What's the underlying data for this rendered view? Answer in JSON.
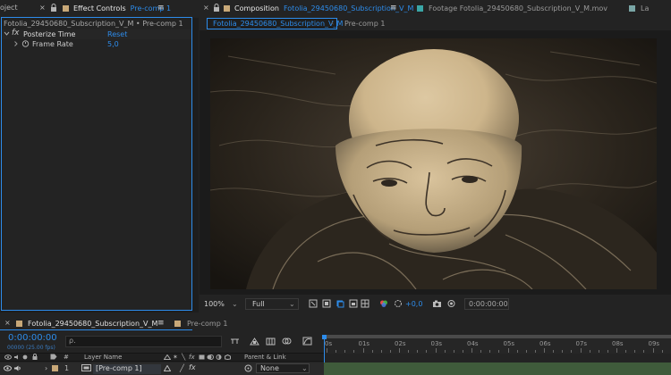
{
  "left_panel": {
    "tabs": [
      {
        "label": "oject"
      },
      {
        "label": "Effect Controls",
        "suffix": "Pre-comp 1"
      }
    ],
    "breadcrumb": "Fotolia_29450680_Subscription_V_M • Pre-comp 1",
    "effect": {
      "name": "Posterize Time",
      "fx_glyph": "fx",
      "reset_label": "Reset",
      "param_label": "Frame Rate",
      "param_value": "5,0"
    }
  },
  "right_panel": {
    "tabs": [
      {
        "label": "Composition",
        "suffix": "Fotolia_29450680_Subscription_V_M"
      },
      {
        "label": "Footage Fotolia_29450680_Subscription_V_M.mov"
      },
      {
        "label": "La"
      }
    ],
    "subtabs": [
      {
        "label": "Fotolia_29450680_Subscription_V_M"
      },
      {
        "label": "Pre-comp 1"
      }
    ]
  },
  "viewer_toolbar": {
    "zoom": "100%",
    "resolution": "Full",
    "exposure": "+0,0",
    "timecode": "0:00:00:00"
  },
  "timeline": {
    "tabs": [
      {
        "label": "Fotolia_29450680_Subscription_V_M"
      },
      {
        "label": "Pre-comp 1"
      }
    ],
    "timecode": "0:00:00:00",
    "frame_info": "00000 (25.00 fps)",
    "search_placeholder": "ρ.",
    "ruler_labels": [
      "0s",
      "01s",
      "02s",
      "03s",
      "04s",
      "05s",
      "06s",
      "07s",
      "08s",
      "09s"
    ],
    "columns": {
      "hash": "#",
      "layer_name": "Layer Name",
      "parent_link": "Parent & Link"
    },
    "layer": {
      "index": "1",
      "name": "[Pre-comp 1]",
      "parent": "None"
    }
  },
  "colors": {
    "accent": "#2d8ceb",
    "label_tan": "#c8a878",
    "layer_bar": "#3f5b3b",
    "playhead": "#2d8ceb"
  }
}
